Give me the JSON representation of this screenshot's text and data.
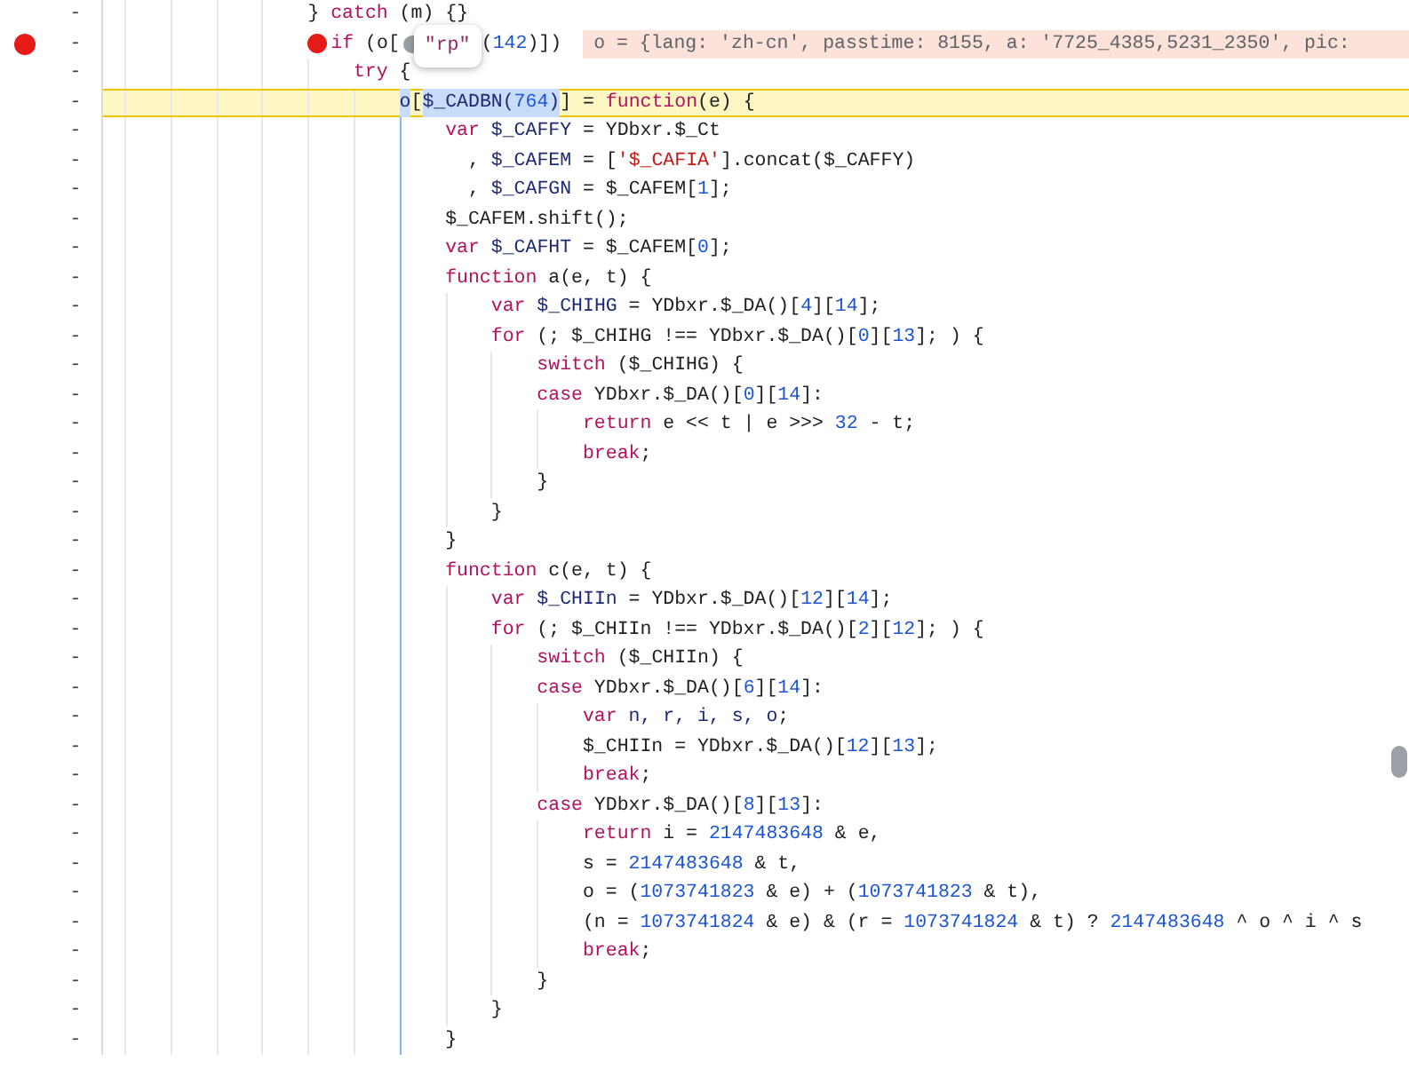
{
  "lines": [
    {
      "breakpoint": false,
      "number": "-",
      "paused": false,
      "tokens": [
        {
          "kind": "plain",
          "text": "} "
        },
        {
          "kind": "keyword",
          "text": "catch"
        },
        {
          "kind": "plain",
          "text": " (m) {}"
        }
      ]
    },
    {
      "breakpoint": true,
      "number": "-",
      "paused": false,
      "preview": "o = {lang: 'zh-cn', passtime: 8155, a: '7725_4385,5231_2350', pic:",
      "tokens": [
        {
          "kind": "breakpoint"
        },
        {
          "kind": "keyword",
          "text": "if"
        },
        {
          "kind": "plain",
          "text": " (o["
        },
        {
          "kind": "popup",
          "text": "\"rp\""
        },
        {
          "kind": "plain",
          "text": "("
        },
        {
          "kind": "number",
          "text": "142"
        },
        {
          "kind": "plain",
          "text": ")])"
        }
      ],
      "children": [
        {
          "breakpoint": false,
          "number": "-",
          "paused": false,
          "tokens": [
            {
              "kind": "keyword",
              "text": "try"
            },
            {
              "kind": "plain",
              "text": " {"
            }
          ],
          "children": [
            {
              "breakpoint": false,
              "number": "-",
              "paused": true,
              "tokens": [
                {
                  "kind": "selected",
                  "text": "o"
                },
                {
                  "kind": "plain",
                  "text": "["
                },
                {
                  "kind": "selected",
                  "text": "$_CADBN("
                },
                {
                  "kind": "selected-number",
                  "text": "764"
                },
                {
                  "kind": "selected",
                  "text": ")"
                },
                {
                  "kind": "plain",
                  "text": "] = "
                },
                {
                  "kind": "keyword",
                  "text": "function"
                },
                {
                  "kind": "plain",
                  "text": "(e) {"
                }
              ],
              "children": [
                {
                  "breakpoint": false,
                  "number": "-",
                  "paused": false,
                  "tokens": [
                    {
                      "kind": "keyword",
                      "text": "var"
                    },
                    {
                      "kind": "variable",
                      "text": " $_CAFFY"
                    },
                    {
                      "kind": "plain",
                      "text": " = YDbxr.$_Ct"
                    }
                  ]
                },
                {
                  "breakpoint": false,
                  "number": "-",
                  "paused": false,
                  "tokens": [
                    {
                      "kind": "plain",
                      "text": "  , "
                    },
                    {
                      "kind": "variable",
                      "text": "$_CAFEM"
                    },
                    {
                      "kind": "plain",
                      "text": " = ["
                    },
                    {
                      "kind": "string",
                      "text": "'$_CAFIA'"
                    },
                    {
                      "kind": "plain",
                      "text": "].concat($_CAFFY)"
                    }
                  ]
                },
                {
                  "breakpoint": false,
                  "number": "-",
                  "paused": false,
                  "tokens": [
                    {
                      "kind": "plain",
                      "text": "  , "
                    },
                    {
                      "kind": "variable",
                      "text": "$_CAFGN"
                    },
                    {
                      "kind": "plain",
                      "text": " = $_CAFEM["
                    },
                    {
                      "kind": "number",
                      "text": "1"
                    },
                    {
                      "kind": "plain",
                      "text": "];"
                    }
                  ]
                },
                {
                  "breakpoint": false,
                  "number": "-",
                  "paused": false,
                  "tokens": [
                    {
                      "kind": "plain",
                      "text": "$_CAFEM.shift();"
                    }
                  ]
                },
                {
                  "breakpoint": false,
                  "number": "-",
                  "paused": false,
                  "tokens": [
                    {
                      "kind": "keyword",
                      "text": "var"
                    },
                    {
                      "kind": "variable",
                      "text": " $_CAFHT"
                    },
                    {
                      "kind": "plain",
                      "text": " = $_CAFEM["
                    },
                    {
                      "kind": "number",
                      "text": "0"
                    },
                    {
                      "kind": "plain",
                      "text": "];"
                    }
                  ]
                },
                {
                  "breakpoint": false,
                  "number": "-",
                  "paused": false,
                  "tokens": [
                    {
                      "kind": "keyword",
                      "text": "function"
                    },
                    {
                      "kind": "plain",
                      "text": " a(e, t) {"
                    }
                  ],
                  "children": [
                    {
                      "breakpoint": false,
                      "number": "-",
                      "paused": false,
                      "tokens": [
                        {
                          "kind": "keyword",
                          "text": "var"
                        },
                        {
                          "kind": "variable",
                          "text": " $_CHIHG"
                        },
                        {
                          "kind": "plain",
                          "text": " = YDbxr.$_DA()["
                        },
                        {
                          "kind": "number",
                          "text": "4"
                        },
                        {
                          "kind": "plain",
                          "text": "]["
                        },
                        {
                          "kind": "number",
                          "text": "14"
                        },
                        {
                          "kind": "plain",
                          "text": "];"
                        }
                      ]
                    },
                    {
                      "breakpoint": false,
                      "number": "-",
                      "paused": false,
                      "tokens": [
                        {
                          "kind": "keyword",
                          "text": "for"
                        },
                        {
                          "kind": "plain",
                          "text": " (; $_CHIHG !== YDbxr.$_DA()["
                        },
                        {
                          "kind": "number",
                          "text": "0"
                        },
                        {
                          "kind": "plain",
                          "text": "]["
                        },
                        {
                          "kind": "number",
                          "text": "13"
                        },
                        {
                          "kind": "plain",
                          "text": "]; ) {"
                        }
                      ],
                      "children": [
                        {
                          "breakpoint": false,
                          "number": "-",
                          "paused": false,
                          "tokens": [
                            {
                              "kind": "keyword",
                              "text": "switch"
                            },
                            {
                              "kind": "plain",
                              "text": " ($_CHIHG) {"
                            }
                          ]
                        },
                        {
                          "breakpoint": false,
                          "number": "-",
                          "paused": false,
                          "tokens": [
                            {
                              "kind": "keyword",
                              "text": "case"
                            },
                            {
                              "kind": "plain",
                              "text": " YDbxr.$_DA()["
                            },
                            {
                              "kind": "number",
                              "text": "0"
                            },
                            {
                              "kind": "plain",
                              "text": "]["
                            },
                            {
                              "kind": "number",
                              "text": "14"
                            },
                            {
                              "kind": "plain",
                              "text": "]:"
                            }
                          ],
                          "children": [
                            {
                              "breakpoint": false,
                              "number": "-",
                              "paused": false,
                              "tokens": [
                                {
                                  "kind": "keyword",
                                  "text": "return"
                                },
                                {
                                  "kind": "plain",
                                  "text": " e << t | e >>> "
                                },
                                {
                                  "kind": "number",
                                  "text": "32"
                                },
                                {
                                  "kind": "plain",
                                  "text": " - t;"
                                }
                              ]
                            },
                            {
                              "breakpoint": false,
                              "number": "-",
                              "paused": false,
                              "tokens": [
                                {
                                  "kind": "keyword",
                                  "text": "break"
                                },
                                {
                                  "kind": "plain",
                                  "text": ";"
                                }
                              ]
                            }
                          ]
                        },
                        {
                          "breakpoint": false,
                          "number": "-",
                          "paused": false,
                          "tokens": [
                            {
                              "kind": "plain",
                              "text": "}"
                            }
                          ]
                        }
                      ]
                    },
                    {
                      "breakpoint": false,
                      "number": "-",
                      "paused": false,
                      "tokens": [
                        {
                          "kind": "plain",
                          "text": "}"
                        }
                      ]
                    }
                  ]
                },
                {
                  "breakpoint": false,
                  "number": "-",
                  "paused": false,
                  "tokens": [
                    {
                      "kind": "plain",
                      "text": "}"
                    }
                  ]
                },
                {
                  "breakpoint": false,
                  "number": "-",
                  "paused": false,
                  "tokens": [
                    {
                      "kind": "keyword",
                      "text": "function"
                    },
                    {
                      "kind": "plain",
                      "text": " c(e, t) {"
                    }
                  ],
                  "children": [
                    {
                      "breakpoint": false,
                      "number": "-",
                      "paused": false,
                      "tokens": [
                        {
                          "kind": "keyword",
                          "text": "var"
                        },
                        {
                          "kind": "variable",
                          "text": " $_CHIIn"
                        },
                        {
                          "kind": "plain",
                          "text": " = YDbxr.$_DA()["
                        },
                        {
                          "kind": "number",
                          "text": "12"
                        },
                        {
                          "kind": "plain",
                          "text": "]["
                        },
                        {
                          "kind": "number",
                          "text": "14"
                        },
                        {
                          "kind": "plain",
                          "text": "];"
                        }
                      ]
                    },
                    {
                      "breakpoint": false,
                      "number": "-",
                      "paused": false,
                      "tokens": [
                        {
                          "kind": "keyword",
                          "text": "for"
                        },
                        {
                          "kind": "plain",
                          "text": " (; $_CHIIn !== YDbxr.$_DA()["
                        },
                        {
                          "kind": "number",
                          "text": "2"
                        },
                        {
                          "kind": "plain",
                          "text": "]["
                        },
                        {
                          "kind": "number",
                          "text": "12"
                        },
                        {
                          "kind": "plain",
                          "text": "]; ) {"
                        }
                      ],
                      "children": [
                        {
                          "breakpoint": false,
                          "number": "-",
                          "paused": false,
                          "tokens": [
                            {
                              "kind": "keyword",
                              "text": "switch"
                            },
                            {
                              "kind": "plain",
                              "text": " ($_CHIIn) {"
                            }
                          ]
                        },
                        {
                          "breakpoint": false,
                          "number": "-",
                          "paused": false,
                          "tokens": [
                            {
                              "kind": "keyword",
                              "text": "case"
                            },
                            {
                              "kind": "plain",
                              "text": " YDbxr.$_DA()["
                            },
                            {
                              "kind": "number",
                              "text": "6"
                            },
                            {
                              "kind": "plain",
                              "text": "]["
                            },
                            {
                              "kind": "number",
                              "text": "14"
                            },
                            {
                              "kind": "plain",
                              "text": "]:"
                            }
                          ],
                          "children": [
                            {
                              "breakpoint": false,
                              "number": "-",
                              "paused": false,
                              "tokens": [
                                {
                                  "kind": "keyword",
                                  "text": "var"
                                },
                                {
                                  "kind": "variable",
                                  "text": " n, r, i, s, o"
                                },
                                {
                                  "kind": "plain",
                                  "text": ";"
                                }
                              ]
                            },
                            {
                              "breakpoint": false,
                              "number": "-",
                              "paused": false,
                              "tokens": [
                                {
                                  "kind": "plain",
                                  "text": "$_CHIIn = YDbxr.$_DA()["
                                },
                                {
                                  "kind": "number",
                                  "text": "12"
                                },
                                {
                                  "kind": "plain",
                                  "text": "]["
                                },
                                {
                                  "kind": "number",
                                  "text": "13"
                                },
                                {
                                  "kind": "plain",
                                  "text": "];"
                                }
                              ]
                            },
                            {
                              "breakpoint": false,
                              "number": "-",
                              "paused": false,
                              "tokens": [
                                {
                                  "kind": "keyword",
                                  "text": "break"
                                },
                                {
                                  "kind": "plain",
                                  "text": ";"
                                }
                              ]
                            }
                          ]
                        },
                        {
                          "breakpoint": false,
                          "number": "-",
                          "paused": false,
                          "tokens": [
                            {
                              "kind": "keyword",
                              "text": "case"
                            },
                            {
                              "kind": "plain",
                              "text": " YDbxr.$_DA()["
                            },
                            {
                              "kind": "number",
                              "text": "8"
                            },
                            {
                              "kind": "plain",
                              "text": "]["
                            },
                            {
                              "kind": "number",
                              "text": "13"
                            },
                            {
                              "kind": "plain",
                              "text": "]:"
                            }
                          ],
                          "children": [
                            {
                              "breakpoint": false,
                              "number": "-",
                              "paused": false,
                              "tokens": [
                                {
                                  "kind": "keyword",
                                  "text": "return"
                                },
                                {
                                  "kind": "plain",
                                  "text": " i = "
                                },
                                {
                                  "kind": "number",
                                  "text": "2147483648"
                                },
                                {
                                  "kind": "plain",
                                  "text": " & e,"
                                }
                              ]
                            },
                            {
                              "breakpoint": false,
                              "number": "-",
                              "paused": false,
                              "tokens": [
                                {
                                  "kind": "plain",
                                  "text": "s = "
                                },
                                {
                                  "kind": "number",
                                  "text": "2147483648"
                                },
                                {
                                  "kind": "plain",
                                  "text": " & t,"
                                }
                              ]
                            },
                            {
                              "breakpoint": false,
                              "number": "-",
                              "paused": false,
                              "tokens": [
                                {
                                  "kind": "plain",
                                  "text": "o = ("
                                },
                                {
                                  "kind": "number",
                                  "text": "1073741823"
                                },
                                {
                                  "kind": "plain",
                                  "text": " & e) + ("
                                },
                                {
                                  "kind": "number",
                                  "text": "1073741823"
                                },
                                {
                                  "kind": "plain",
                                  "text": " & t),"
                                }
                              ]
                            },
                            {
                              "breakpoint": false,
                              "number": "-",
                              "paused": false,
                              "tokens": [
                                {
                                  "kind": "plain",
                                  "text": "(n = "
                                },
                                {
                                  "kind": "number",
                                  "text": "1073741824"
                                },
                                {
                                  "kind": "plain",
                                  "text": " & e) & (r = "
                                },
                                {
                                  "kind": "number",
                                  "text": "1073741824"
                                },
                                {
                                  "kind": "plain",
                                  "text": " & t) ? "
                                },
                                {
                                  "kind": "number",
                                  "text": "2147483648"
                                },
                                {
                                  "kind": "plain",
                                  "text": " ^ o ^ i ^ s"
                                }
                              ]
                            },
                            {
                              "breakpoint": false,
                              "number": "-",
                              "paused": false,
                              "tokens": [
                                {
                                  "kind": "keyword",
                                  "text": "break"
                                },
                                {
                                  "kind": "plain",
                                  "text": ";"
                                }
                              ]
                            }
                          ]
                        },
                        {
                          "breakpoint": false,
                          "number": "-",
                          "paused": false,
                          "tokens": [
                            {
                              "kind": "plain",
                              "text": "}"
                            }
                          ]
                        }
                      ]
                    },
                    {
                      "breakpoint": false,
                      "number": "-",
                      "paused": false,
                      "tokens": [
                        {
                          "kind": "plain",
                          "text": "}"
                        }
                      ]
                    }
                  ]
                },
                {
                  "breakpoint": false,
                  "number": "-",
                  "paused": false,
                  "tokens": [
                    {
                      "kind": "plain",
                      "text": "}"
                    }
                  ]
                }
              ]
            }
          ]
        }
      ]
    }
  ]
}
